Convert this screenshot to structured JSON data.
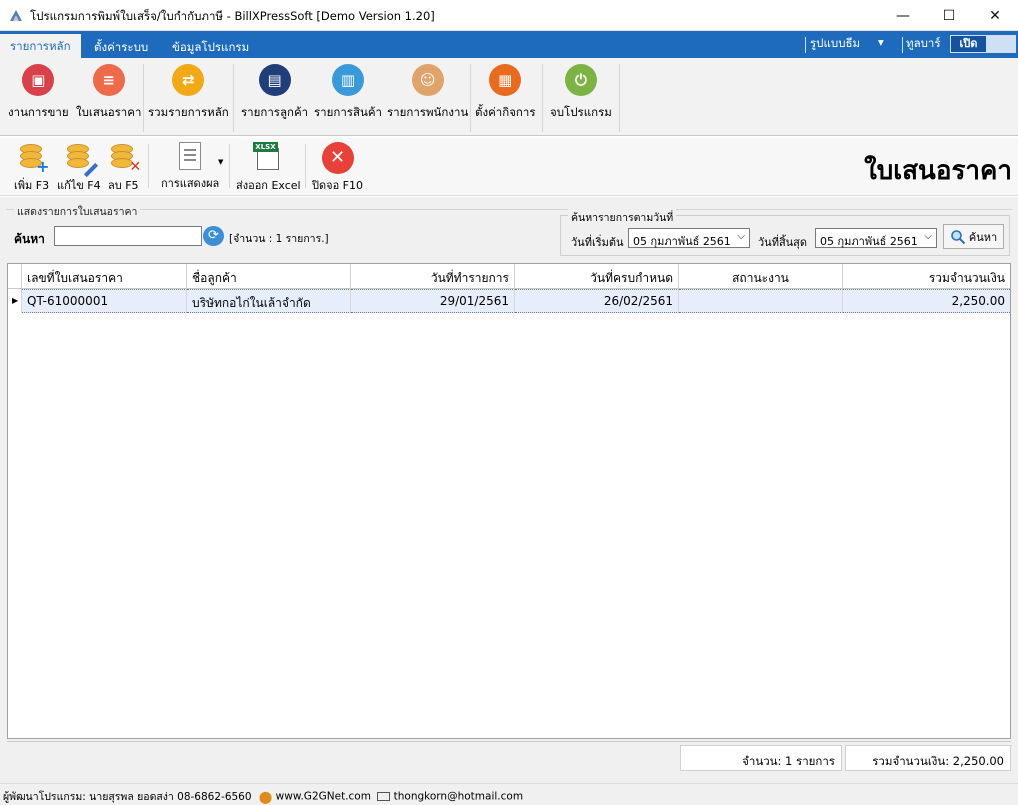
{
  "window": {
    "title": "โปรแกรมการพิมพ์ใบเสร็จ/ใบกำกับภาษี - BillXPressSoft [Demo Version 1.20]",
    "minimize": "—",
    "maximize": "☐",
    "close": "✕"
  },
  "ribbon_tabs": {
    "tabs": [
      {
        "label": "รายการหลัก"
      },
      {
        "label": "ตั้งค่าระบบ"
      },
      {
        "label": "ข้อมูลโปรแกรม"
      }
    ],
    "theme_label": "รูปแบบธีม",
    "theme_arrow": "▾",
    "toolbar_label": "ทูลบาร์",
    "toggle_label": "เปิด"
  },
  "ribbon": {
    "items": [
      {
        "label": "งานการขาย",
        "icon": "cash-register-icon",
        "color": "#d9414a",
        "glyph": "▣"
      },
      {
        "label": "ใบเสนอราคา",
        "icon": "quotation-icon",
        "color": "#ef6a4a",
        "glyph": "≡"
      },
      {
        "label": "รวมรายการหลัก",
        "icon": "exchange-icon",
        "color": "#f2a916",
        "glyph": "⇄"
      },
      {
        "label": "รายการลูกค้า",
        "icon": "customer-card-icon",
        "color": "#1f3e7a",
        "glyph": "▤"
      },
      {
        "label": "รายการสินค้า",
        "icon": "products-icon",
        "color": "#3a9ad9",
        "glyph": "▥"
      },
      {
        "label": "รายการพนักงาน",
        "icon": "employees-icon",
        "color": "#e0a36a",
        "glyph": "☺"
      },
      {
        "label": "ตั้งค่ากิจการ",
        "icon": "business-settings-icon",
        "color": "#ea6a1e",
        "glyph": "▦"
      },
      {
        "label": "จบโปรแกรม",
        "icon": "power-icon",
        "color": "#7cb342",
        "glyph": "⏻"
      }
    ]
  },
  "toolbar": {
    "add_label": "เพิ่ม F3",
    "edit_label": "แก้ไข F4",
    "delete_label": "ลบ F5",
    "view_label": "การแสดงผล",
    "export_label": "ส่งออก Excel",
    "export_badge": "XLSX",
    "close_label": "ปิดจอ F10",
    "page_title": "ใบเสนอราคา"
  },
  "filter": {
    "group_label": "แสดงรายการใบเสนอราคา",
    "search_label": "ค้นหา",
    "search_value": "",
    "count_text": "[จำนวน : 1 รายการ.]",
    "date_group_label": "ค้นหารายการตามวันที่",
    "start_label": "วันที่เริ่มต้น",
    "start_value": "05 กุมภาพันธ์   2561",
    "end_label": "วันที่สิ้นสุด",
    "end_value": "05 กุมภาพันธ์   2561",
    "find_button": "ค้นหา"
  },
  "table": {
    "columns": [
      "เลขที่ใบเสนอราคา",
      "ชื่อลูกค้า",
      "วันที่ทำรายการ",
      "วันที่ครบกำหนด",
      "สถานะงาน",
      "รวมจำนวนเงิน"
    ],
    "rows": [
      {
        "number": "QT-61000001",
        "customer": "บริษัทกอไก่ในเล้าจำกัด",
        "date": "29/01/2561",
        "due": "26/02/2561",
        "status": "",
        "total": "2,250.00"
      }
    ],
    "row_marker": "▶"
  },
  "summary": {
    "count": "จำนวน: 1 รายการ",
    "total": "รวมจำนวนเงิน: 2,250.00"
  },
  "statusbar": {
    "developer": "ผู้พัฒนาโปรแกรม: นายสุรพล ยอดสง่า 08-6862-6560",
    "website": "www.G2GNet.com",
    "email": "thongkorn@hotmail.com"
  }
}
